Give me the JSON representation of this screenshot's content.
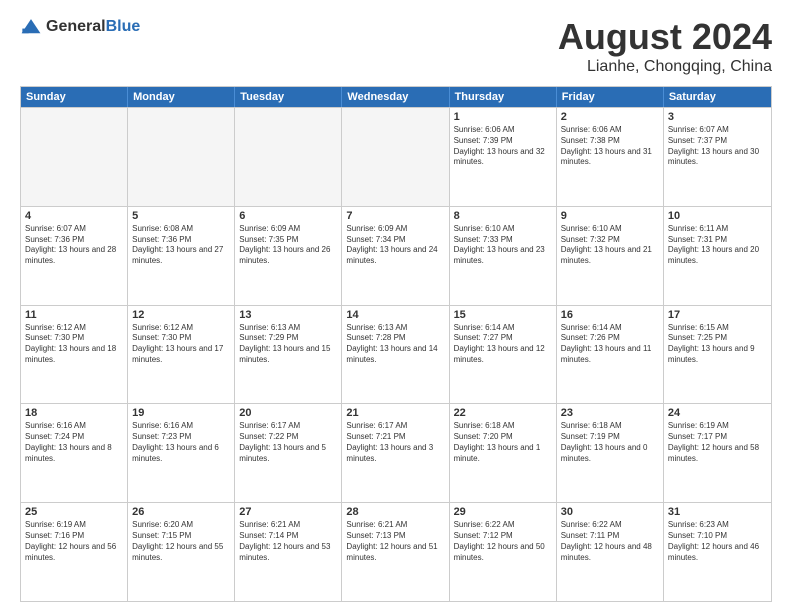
{
  "header": {
    "logo": {
      "general": "General",
      "blue": "Blue"
    },
    "title": "August 2024",
    "subtitle": "Lianhe, Chongqing, China"
  },
  "calendar": {
    "days": [
      "Sunday",
      "Monday",
      "Tuesday",
      "Wednesday",
      "Thursday",
      "Friday",
      "Saturday"
    ],
    "rows": [
      [
        {
          "day": "",
          "empty": true
        },
        {
          "day": "",
          "empty": true
        },
        {
          "day": "",
          "empty": true
        },
        {
          "day": "",
          "empty": true
        },
        {
          "day": "1",
          "sunrise": "Sunrise: 6:06 AM",
          "sunset": "Sunset: 7:39 PM",
          "daylight": "Daylight: 13 hours and 32 minutes."
        },
        {
          "day": "2",
          "sunrise": "Sunrise: 6:06 AM",
          "sunset": "Sunset: 7:38 PM",
          "daylight": "Daylight: 13 hours and 31 minutes."
        },
        {
          "day": "3",
          "sunrise": "Sunrise: 6:07 AM",
          "sunset": "Sunset: 7:37 PM",
          "daylight": "Daylight: 13 hours and 30 minutes."
        }
      ],
      [
        {
          "day": "4",
          "sunrise": "Sunrise: 6:07 AM",
          "sunset": "Sunset: 7:36 PM",
          "daylight": "Daylight: 13 hours and 28 minutes."
        },
        {
          "day": "5",
          "sunrise": "Sunrise: 6:08 AM",
          "sunset": "Sunset: 7:36 PM",
          "daylight": "Daylight: 13 hours and 27 minutes."
        },
        {
          "day": "6",
          "sunrise": "Sunrise: 6:09 AM",
          "sunset": "Sunset: 7:35 PM",
          "daylight": "Daylight: 13 hours and 26 minutes."
        },
        {
          "day": "7",
          "sunrise": "Sunrise: 6:09 AM",
          "sunset": "Sunset: 7:34 PM",
          "daylight": "Daylight: 13 hours and 24 minutes."
        },
        {
          "day": "8",
          "sunrise": "Sunrise: 6:10 AM",
          "sunset": "Sunset: 7:33 PM",
          "daylight": "Daylight: 13 hours and 23 minutes."
        },
        {
          "day": "9",
          "sunrise": "Sunrise: 6:10 AM",
          "sunset": "Sunset: 7:32 PM",
          "daylight": "Daylight: 13 hours and 21 minutes."
        },
        {
          "day": "10",
          "sunrise": "Sunrise: 6:11 AM",
          "sunset": "Sunset: 7:31 PM",
          "daylight": "Daylight: 13 hours and 20 minutes."
        }
      ],
      [
        {
          "day": "11",
          "sunrise": "Sunrise: 6:12 AM",
          "sunset": "Sunset: 7:30 PM",
          "daylight": "Daylight: 13 hours and 18 minutes."
        },
        {
          "day": "12",
          "sunrise": "Sunrise: 6:12 AM",
          "sunset": "Sunset: 7:30 PM",
          "daylight": "Daylight: 13 hours and 17 minutes."
        },
        {
          "day": "13",
          "sunrise": "Sunrise: 6:13 AM",
          "sunset": "Sunset: 7:29 PM",
          "daylight": "Daylight: 13 hours and 15 minutes."
        },
        {
          "day": "14",
          "sunrise": "Sunrise: 6:13 AM",
          "sunset": "Sunset: 7:28 PM",
          "daylight": "Daylight: 13 hours and 14 minutes."
        },
        {
          "day": "15",
          "sunrise": "Sunrise: 6:14 AM",
          "sunset": "Sunset: 7:27 PM",
          "daylight": "Daylight: 13 hours and 12 minutes."
        },
        {
          "day": "16",
          "sunrise": "Sunrise: 6:14 AM",
          "sunset": "Sunset: 7:26 PM",
          "daylight": "Daylight: 13 hours and 11 minutes."
        },
        {
          "day": "17",
          "sunrise": "Sunrise: 6:15 AM",
          "sunset": "Sunset: 7:25 PM",
          "daylight": "Daylight: 13 hours and 9 minutes."
        }
      ],
      [
        {
          "day": "18",
          "sunrise": "Sunrise: 6:16 AM",
          "sunset": "Sunset: 7:24 PM",
          "daylight": "Daylight: 13 hours and 8 minutes."
        },
        {
          "day": "19",
          "sunrise": "Sunrise: 6:16 AM",
          "sunset": "Sunset: 7:23 PM",
          "daylight": "Daylight: 13 hours and 6 minutes."
        },
        {
          "day": "20",
          "sunrise": "Sunrise: 6:17 AM",
          "sunset": "Sunset: 7:22 PM",
          "daylight": "Daylight: 13 hours and 5 minutes."
        },
        {
          "day": "21",
          "sunrise": "Sunrise: 6:17 AM",
          "sunset": "Sunset: 7:21 PM",
          "daylight": "Daylight: 13 hours and 3 minutes."
        },
        {
          "day": "22",
          "sunrise": "Sunrise: 6:18 AM",
          "sunset": "Sunset: 7:20 PM",
          "daylight": "Daylight: 13 hours and 1 minute."
        },
        {
          "day": "23",
          "sunrise": "Sunrise: 6:18 AM",
          "sunset": "Sunset: 7:19 PM",
          "daylight": "Daylight: 13 hours and 0 minutes."
        },
        {
          "day": "24",
          "sunrise": "Sunrise: 6:19 AM",
          "sunset": "Sunset: 7:17 PM",
          "daylight": "Daylight: 12 hours and 58 minutes."
        }
      ],
      [
        {
          "day": "25",
          "sunrise": "Sunrise: 6:19 AM",
          "sunset": "Sunset: 7:16 PM",
          "daylight": "Daylight: 12 hours and 56 minutes."
        },
        {
          "day": "26",
          "sunrise": "Sunrise: 6:20 AM",
          "sunset": "Sunset: 7:15 PM",
          "daylight": "Daylight: 12 hours and 55 minutes."
        },
        {
          "day": "27",
          "sunrise": "Sunrise: 6:21 AM",
          "sunset": "Sunset: 7:14 PM",
          "daylight": "Daylight: 12 hours and 53 minutes."
        },
        {
          "day": "28",
          "sunrise": "Sunrise: 6:21 AM",
          "sunset": "Sunset: 7:13 PM",
          "daylight": "Daylight: 12 hours and 51 minutes."
        },
        {
          "day": "29",
          "sunrise": "Sunrise: 6:22 AM",
          "sunset": "Sunset: 7:12 PM",
          "daylight": "Daylight: 12 hours and 50 minutes."
        },
        {
          "day": "30",
          "sunrise": "Sunrise: 6:22 AM",
          "sunset": "Sunset: 7:11 PM",
          "daylight": "Daylight: 12 hours and 48 minutes."
        },
        {
          "day": "31",
          "sunrise": "Sunrise: 6:23 AM",
          "sunset": "Sunset: 7:10 PM",
          "daylight": "Daylight: 12 hours and 46 minutes."
        }
      ]
    ]
  }
}
